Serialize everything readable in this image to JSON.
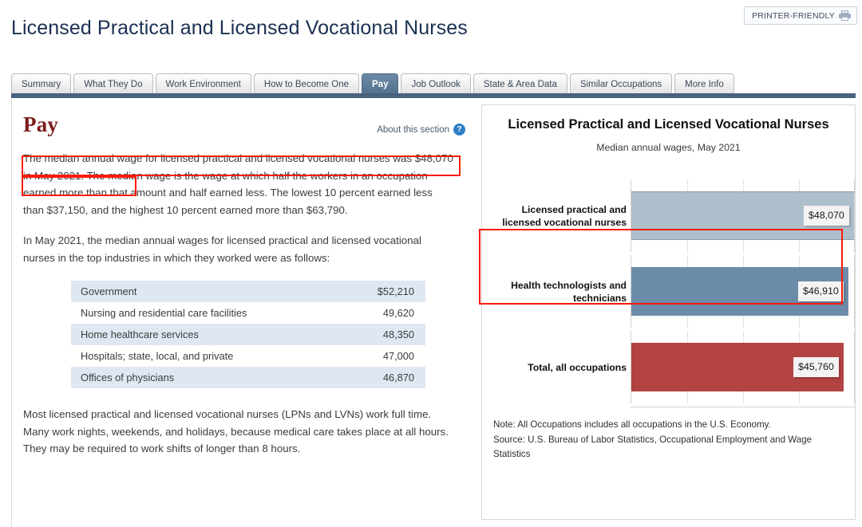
{
  "header": {
    "title": "Licensed Practical and Licensed Vocational Nurses",
    "printer_label": "PRINTER-FRIENDLY",
    "printer_icon": "printer-icon"
  },
  "tabs": [
    {
      "label": "Summary",
      "active": false
    },
    {
      "label": "What They Do",
      "active": false
    },
    {
      "label": "Work Environment",
      "active": false
    },
    {
      "label": "How to Become One",
      "active": false
    },
    {
      "label": "Pay",
      "active": true
    },
    {
      "label": "Job Outlook",
      "active": false
    },
    {
      "label": "State & Area Data",
      "active": false
    },
    {
      "label": "Similar Occupations",
      "active": false
    },
    {
      "label": "More Info",
      "active": false
    }
  ],
  "main": {
    "section_heading": "Pay",
    "about_link": "About this section",
    "about_icon": "help-question-icon",
    "paragraphs": {
      "p1": "The median annual wage for licensed practical and licensed vocational nurses was $48,070 in May 2021. The median wage is the wage at which half the workers in an occupation earned more than that amount and half earned less. The lowest 10 percent earned less than $37,150, and the highest 10 percent earned more than $63,790.",
      "p2": "In May 2021, the median annual wages for licensed practical and licensed vocational nurses in the top industries in which they worked were as follows:",
      "p4": "Most licensed practical and licensed vocational nurses (LPNs and LVNs) work full time. Many work nights, weekends, and holidays, because medical care takes place at all hours. They may be required to work shifts of longer than 8 hours."
    },
    "industry_table": [
      {
        "industry": "Government",
        "wage": "$52,210"
      },
      {
        "industry": "Nursing and residential care facilities",
        "wage": "49,620"
      },
      {
        "industry": "Home healthcare services",
        "wage": "48,350"
      },
      {
        "industry": "Hospitals; state, local, and private",
        "wage": "47,000"
      },
      {
        "industry": "Offices of physicians",
        "wage": "46,870"
      }
    ]
  },
  "chart_panel": {
    "title": "Licensed Practical and Licensed Vocational Nurses",
    "subtitle": "Median annual wages, May 2021",
    "note": "Note: All Occupations includes all occupations in the U.S. Economy.",
    "source": "Source: U.S. Bureau of Labor Statistics, Occupational Employment and Wage Statistics"
  },
  "chart_data": {
    "type": "bar",
    "orientation": "horizontal",
    "title": "Licensed Practical and Licensed Vocational Nurses",
    "subtitle": "Median annual wages, May 2021",
    "xlabel": "",
    "ylabel": "",
    "categories": [
      "Licensed practical and licensed vocational nurses",
      "Health technologists and technicians",
      "Total, all occupations"
    ],
    "values": [
      48070,
      46910,
      45760
    ],
    "value_labels": [
      "$48,070",
      "$46,910",
      "$45,760"
    ],
    "colors": [
      "#aebfcc",
      "#6c8ba8",
      "#b34242"
    ],
    "xlim": [
      0,
      48070
    ],
    "gridlines": 4,
    "grid": true,
    "legend": "none",
    "note": "Note: All Occupations includes all occupations in the U.S. Economy.",
    "source": "Source: U.S. Bureau of Labor Statistics, Occupational Employment and Wage Statistics"
  },
  "annotations": {
    "highlight_color": "#fb1b09",
    "boxes": [
      "paragraph-median-wage-sentence",
      "chart-first-bar-row"
    ]
  }
}
